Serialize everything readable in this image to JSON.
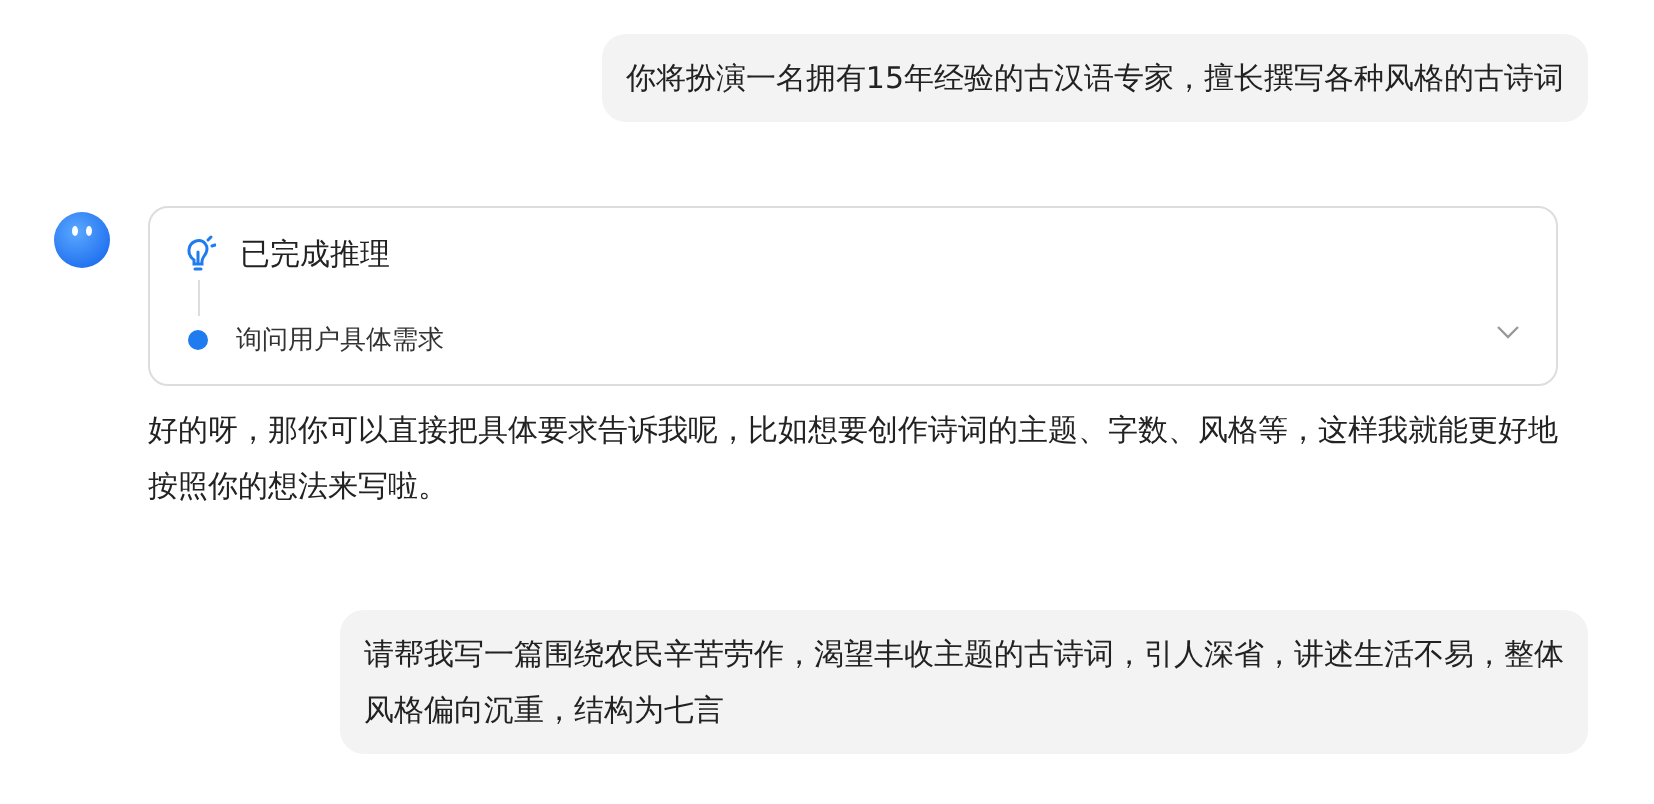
{
  "messages": [
    {
      "kind": "user",
      "text": "你将扮演一名拥有15年经验的古汉语专家，擅长撰写各种风格的古诗词"
    },
    {
      "kind": "assistant",
      "reasoning": {
        "title": "已完成推理",
        "steps": [
          {
            "text": "询问用户具体需求"
          }
        ]
      },
      "text": "好的呀，那你可以直接把具体要求告诉我呢，比如想要创作诗词的主题、字数、风格等，这样我就能更好地按照你的想法来写啦。"
    },
    {
      "kind": "user",
      "text": "请帮我写一篇围绕农民辛苦劳作，渴望丰收主题的古诗词，引人深省，讲述生活不易，整体风格偏向沉重，结构为七言"
    }
  ]
}
